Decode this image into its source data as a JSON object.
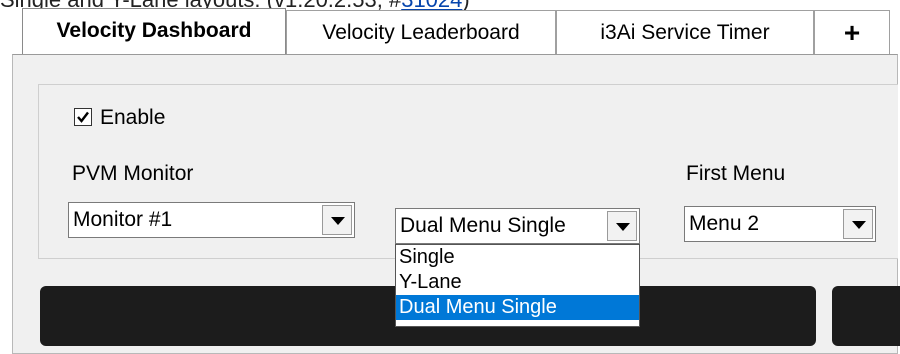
{
  "top_text": {
    "prefix": "Single and Y-Lane layouts. (v1.20.2.53, #",
    "link": "31024",
    "suffix": ")"
  },
  "tabs": [
    {
      "label": "Velocity Dashboard",
      "active": true
    },
    {
      "label": "Velocity Leaderboard",
      "active": false
    },
    {
      "label": "i3Ai Service Timer",
      "active": false
    },
    {
      "label": "+",
      "active": false
    }
  ],
  "enable": {
    "label": "Enable",
    "checked": true
  },
  "pvm_monitor": {
    "label": "PVM Monitor",
    "value": "Monitor #1"
  },
  "layout": {
    "value": "Dual Menu Single",
    "options": [
      "Single",
      "Y-Lane",
      "Dual Menu Single"
    ],
    "selected_index": 2
  },
  "first_menu": {
    "label": "First Menu",
    "value": "Menu 2"
  },
  "colors": {
    "selection": "#0078d7",
    "panel": "#f0f0f0",
    "card": "#1c1c1c"
  }
}
